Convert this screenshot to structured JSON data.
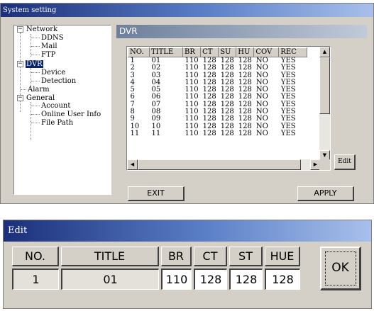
{
  "system_window": {
    "title": "System setting",
    "tree": {
      "network": "Network",
      "ddns": "DDNS",
      "mail": "Mail",
      "ftp": "FTP",
      "dvr": "DVR",
      "device": "Device",
      "detection": "Detection",
      "alarm": "Alarm",
      "general": "General",
      "account": "Account",
      "online_user_info": "Online User Info",
      "file_path": "File Path"
    },
    "panel_title": "DVR",
    "list": {
      "columns": [
        "NO.",
        "TITLE",
        "BR",
        "CT",
        "SU",
        "HU",
        "COV",
        "REC"
      ],
      "rows": [
        [
          "1",
          "01",
          "110",
          "128",
          "128",
          "128",
          "NO",
          "YES"
        ],
        [
          "2",
          "02",
          "110",
          "128",
          "128",
          "128",
          "NO",
          "YES"
        ],
        [
          "3",
          "03",
          "110",
          "128",
          "128",
          "128",
          "NO",
          "YES"
        ],
        [
          "4",
          "04",
          "110",
          "128",
          "128",
          "128",
          "NO",
          "YES"
        ],
        [
          "5",
          "05",
          "110",
          "128",
          "128",
          "128",
          "NO",
          "YES"
        ],
        [
          "6",
          "06",
          "110",
          "128",
          "128",
          "128",
          "NO",
          "YES"
        ],
        [
          "7",
          "07",
          "110",
          "128",
          "128",
          "128",
          "NO",
          "YES"
        ],
        [
          "8",
          "08",
          "110",
          "128",
          "128",
          "128",
          "NO",
          "YES"
        ],
        [
          "9",
          "09",
          "110",
          "128",
          "128",
          "128",
          "NO",
          "YES"
        ],
        [
          "10",
          "10",
          "110",
          "128",
          "128",
          "128",
          "NO",
          "YES"
        ],
        [
          "11",
          "11",
          "110",
          "128",
          "128",
          "128",
          "NO",
          "YES"
        ]
      ]
    },
    "edit_button": "Edit",
    "exit_button": "EXIT",
    "apply_button": "APPLY"
  },
  "edit_dialog": {
    "title": "Edit",
    "headers": {
      "no": "NO.",
      "title": "TITLE",
      "br": "BR",
      "ct": "CT",
      "st": "ST",
      "hue": "HUE"
    },
    "values": {
      "no": "1",
      "title": "01",
      "br": "110",
      "ct": "128",
      "st": "128",
      "hue": "128"
    },
    "ok_button": "OK"
  },
  "icons": {
    "expand_collapse": "minus-box-icon",
    "scroll_up": "arrow-up-icon",
    "scroll_down": "arrow-down-icon",
    "scroll_left": "arrow-left-icon",
    "scroll_right": "arrow-right-icon"
  },
  "colors": {
    "titlebar_start": "#1b2f7a",
    "titlebar_end": "#a8c0ea",
    "selection": "#0a246a",
    "face": "#d4d0c8"
  }
}
